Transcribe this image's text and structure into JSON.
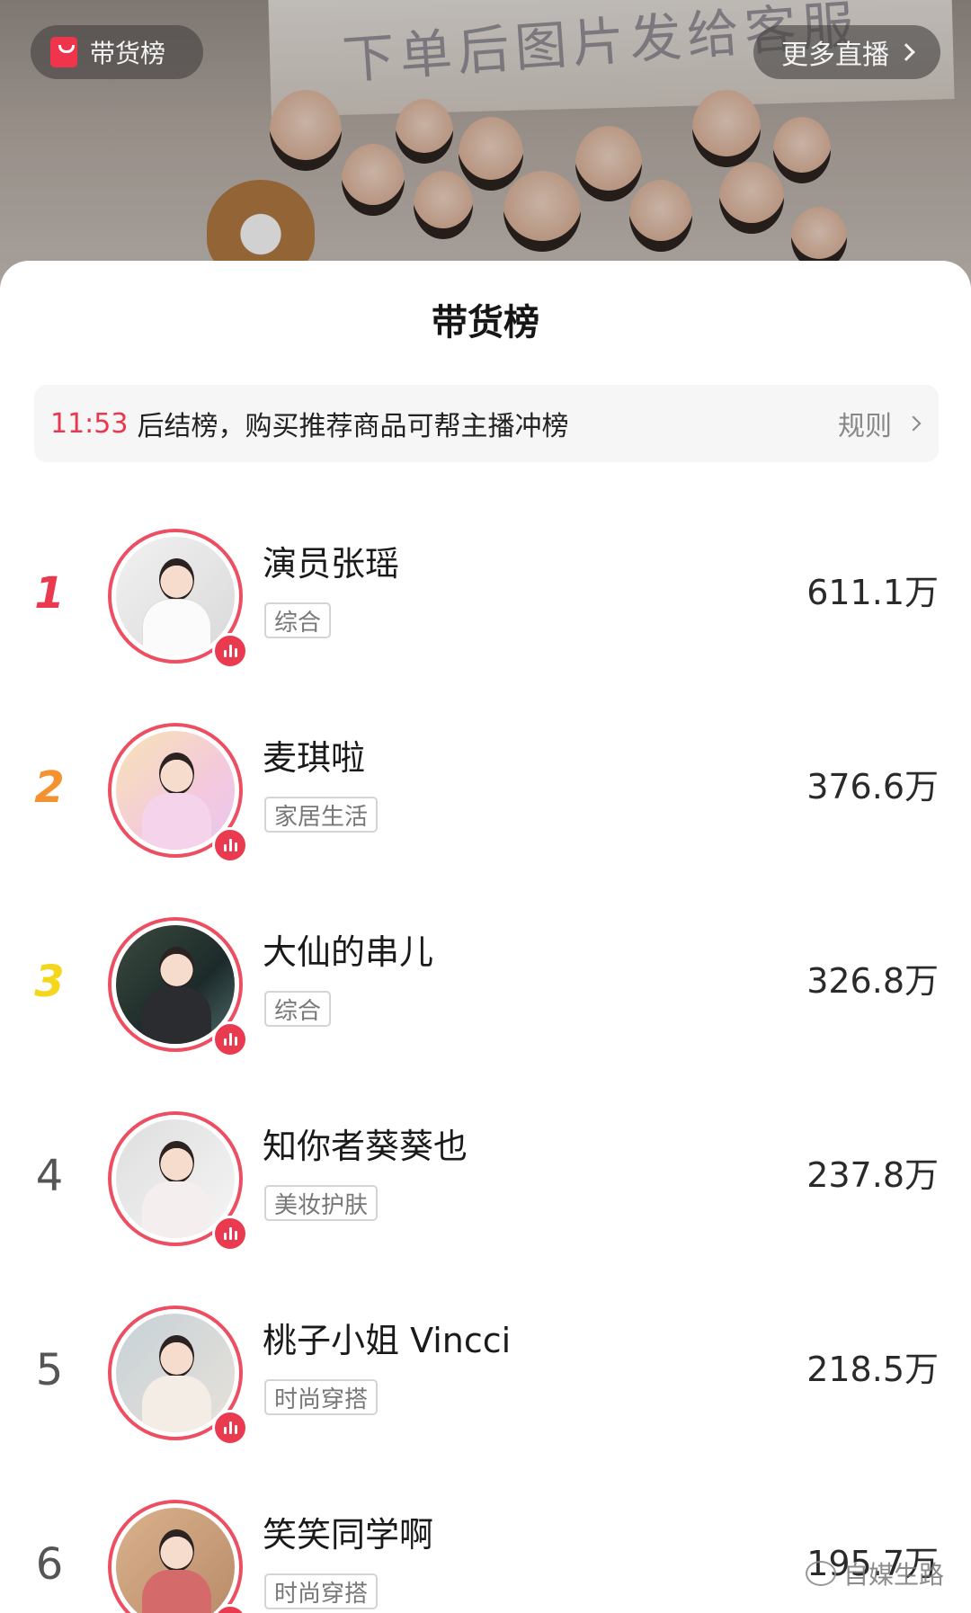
{
  "header": {
    "rank_chip_label": "带货榜",
    "more_live_label": "更多直播",
    "background_text": "下单后图片发给客服"
  },
  "sheet": {
    "title": "带货榜",
    "notice": {
      "countdown": "11:53",
      "message": "后结榜，购买推荐商品可帮主播冲榜",
      "rules_label": "规则"
    }
  },
  "ranking": [
    {
      "rank": "1",
      "name": "演员张瑶",
      "category": "综合",
      "amount": "611.1万"
    },
    {
      "rank": "2",
      "name": "麦琪啦",
      "category": "家居生活",
      "amount": "376.6万"
    },
    {
      "rank": "3",
      "name": "大仙的串儿",
      "category": "综合",
      "amount": "326.8万"
    },
    {
      "rank": "4",
      "name": "知你者葵葵也",
      "category": "美妆护肤",
      "amount": "237.8万"
    },
    {
      "rank": "5",
      "name": "桃子小姐 Vincci",
      "category": "时尚穿搭",
      "amount": "218.5万"
    },
    {
      "rank": "6",
      "name": "笑笑同学啊",
      "category": "时尚穿搭",
      "amount": "195.7万"
    }
  ],
  "watermark": "自媒生路",
  "colors": {
    "accent": "#ea3a50",
    "rank1": "#ea3a50",
    "rank2": "#f3922e",
    "rank3": "#f4d61d"
  }
}
